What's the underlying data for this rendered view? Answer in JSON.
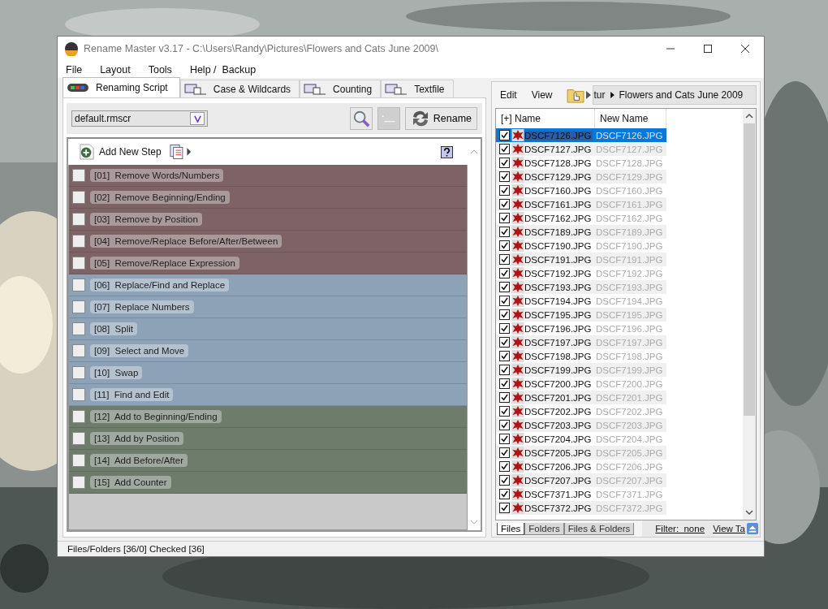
{
  "window": {
    "title": "Rename Master v3.17 - C:\\Users\\Randy\\Pictures\\Flowers and Cats June 2009\\"
  },
  "menu": [
    "File",
    "Layout",
    "Tools",
    "Help /  Backup"
  ],
  "tabs": [
    {
      "label": "Renaming Script",
      "selected": true
    },
    {
      "label": "Case & Wildcards",
      "selected": false
    },
    {
      "label": "Counting",
      "selected": false
    },
    {
      "label": "Textfile",
      "selected": false
    }
  ],
  "script_field": {
    "value": "default.rmscr"
  },
  "rename_button": "Rename",
  "add_step": "Add New Step",
  "steps": [
    {
      "label": "[01]  Remove Words/Numbers",
      "checked": false,
      "color": "#7d6366"
    },
    {
      "label": "[02]  Remove Beginning/Ending",
      "checked": false,
      "color": "#7d6366"
    },
    {
      "label": "[03]  Remove by Position",
      "checked": false,
      "color": "#7d6366"
    },
    {
      "label": "[04]  Remove/Replace Before/After/Between",
      "checked": false,
      "color": "#7d6366"
    },
    {
      "label": "[05]  Remove/Replace Expression",
      "checked": false,
      "color": "#7d6366"
    },
    {
      "label": "[06]  Replace/Find and Replace",
      "checked": false,
      "color": "#8da1b7"
    },
    {
      "label": "[07]  Replace Numbers",
      "checked": false,
      "color": "#8da1b7"
    },
    {
      "label": "[08]  Split",
      "checked": false,
      "color": "#8da1b7"
    },
    {
      "label": "[09]  Select and Move",
      "checked": false,
      "color": "#8da1b7"
    },
    {
      "label": "[10]  Swap",
      "checked": false,
      "color": "#8da1b7"
    },
    {
      "label": "[11]  Find and Edit",
      "checked": false,
      "color": "#8da1b7"
    },
    {
      "label": "[12]  Add to Beginning/Ending",
      "checked": false,
      "color": "#6e7c6c"
    },
    {
      "label": "[13]  Add by Position",
      "checked": false,
      "color": "#6e7c6c"
    },
    {
      "label": "[14]  Add Before/After",
      "checked": false,
      "color": "#6e7c6c"
    },
    {
      "label": "[15]  Add Counter",
      "checked": false,
      "color": "#6e7c6c"
    }
  ],
  "right_menu": [
    "Edit",
    "View"
  ],
  "path": {
    "cut": "tur",
    "folder": "Flowers and Cats June 2009"
  },
  "table": {
    "columns": [
      "[+] Name",
      "New Name"
    ],
    "rows": [
      {
        "name": "DSCF7126.JPG",
        "new_name": "DSCF7126.JPG",
        "checked": true,
        "selected": true
      },
      {
        "name": "DSCF7127.JPG",
        "new_name": "DSCF7127.JPG",
        "checked": true,
        "selected": false
      },
      {
        "name": "DSCF7128.JPG",
        "new_name": "DSCF7128.JPG",
        "checked": true,
        "selected": false
      },
      {
        "name": "DSCF7129.JPG",
        "new_name": "DSCF7129.JPG",
        "checked": true,
        "selected": false
      },
      {
        "name": "DSCF7160.JPG",
        "new_name": "DSCF7160.JPG",
        "checked": true,
        "selected": false
      },
      {
        "name": "DSCF7161.JPG",
        "new_name": "DSCF7161.JPG",
        "checked": true,
        "selected": false
      },
      {
        "name": "DSCF7162.JPG",
        "new_name": "DSCF7162.JPG",
        "checked": true,
        "selected": false
      },
      {
        "name": "DSCF7189.JPG",
        "new_name": "DSCF7189.JPG",
        "checked": true,
        "selected": false
      },
      {
        "name": "DSCF7190.JPG",
        "new_name": "DSCF7190.JPG",
        "checked": true,
        "selected": false
      },
      {
        "name": "DSCF7191.JPG",
        "new_name": "DSCF7191.JPG",
        "checked": true,
        "selected": false
      },
      {
        "name": "DSCF7192.JPG",
        "new_name": "DSCF7192.JPG",
        "checked": true,
        "selected": false
      },
      {
        "name": "DSCF7193.JPG",
        "new_name": "DSCF7193.JPG",
        "checked": true,
        "selected": false
      },
      {
        "name": "DSCF7194.JPG",
        "new_name": "DSCF7194.JPG",
        "checked": true,
        "selected": false
      },
      {
        "name": "DSCF7195.JPG",
        "new_name": "DSCF7195.JPG",
        "checked": true,
        "selected": false
      },
      {
        "name": "DSCF7196.JPG",
        "new_name": "DSCF7196.JPG",
        "checked": true,
        "selected": false
      },
      {
        "name": "DSCF7197.JPG",
        "new_name": "DSCF7197.JPG",
        "checked": true,
        "selected": false
      },
      {
        "name": "DSCF7198.JPG",
        "new_name": "DSCF7198.JPG",
        "checked": true,
        "selected": false
      },
      {
        "name": "DSCF7199.JPG",
        "new_name": "DSCF7199.JPG",
        "checked": true,
        "selected": false
      },
      {
        "name": "DSCF7200.JPG",
        "new_name": "DSCF7200.JPG",
        "checked": true,
        "selected": false
      },
      {
        "name": "DSCF7201.JPG",
        "new_name": "DSCF7201.JPG",
        "checked": true,
        "selected": false
      },
      {
        "name": "DSCF7202.JPG",
        "new_name": "DSCF7202.JPG",
        "checked": true,
        "selected": false
      },
      {
        "name": "DSCF7203.JPG",
        "new_name": "DSCF7203.JPG",
        "checked": true,
        "selected": false
      },
      {
        "name": "DSCF7204.JPG",
        "new_name": "DSCF7204.JPG",
        "checked": true,
        "selected": false
      },
      {
        "name": "DSCF7205.JPG",
        "new_name": "DSCF7205.JPG",
        "checked": true,
        "selected": false
      },
      {
        "name": "DSCF7206.JPG",
        "new_name": "DSCF7206.JPG",
        "checked": true,
        "selected": false
      },
      {
        "name": "DSCF7207.JPG",
        "new_name": "DSCF7207.JPG",
        "checked": true,
        "selected": false
      },
      {
        "name": "DSCF7371.JPG",
        "new_name": "DSCF7371.JPG",
        "checked": true,
        "selected": false
      },
      {
        "name": "DSCF7372.JPG",
        "new_name": "DSCF7372.JPG",
        "checked": true,
        "selected": false
      }
    ]
  },
  "bottom_tabs": [
    {
      "label": "Files",
      "selected": true
    },
    {
      "label": "Folders",
      "selected": false
    },
    {
      "label": "Files & Folders",
      "selected": false
    }
  ],
  "filter_link": "Filter:  none",
  "view_link": "View Ta",
  "status_bar": "Files/Folders [36/0] Checked [36]"
}
